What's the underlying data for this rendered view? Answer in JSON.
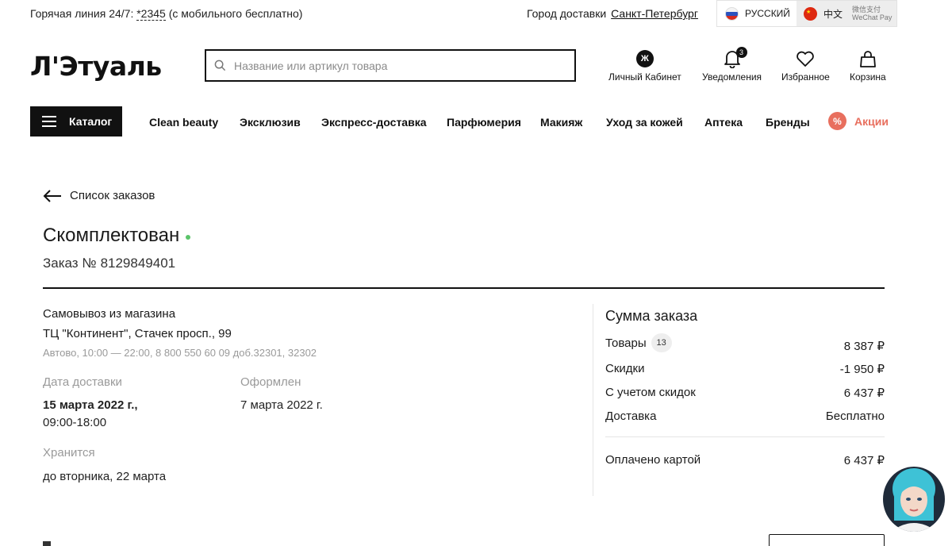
{
  "topbar": {
    "hotline_prefix": "Горячая линия 24/7:",
    "hotline_phone": "*2345",
    "hotline_suffix": "(с мобильного бесплатно)",
    "city_label": "Город доставки",
    "city_value": "Санкт-Петербург",
    "lang_ru": "РУССКИЙ",
    "lang_cn": "中文",
    "wechat_line1": "微信支付",
    "wechat_line2": "WeChat Pay"
  },
  "header": {
    "logo": "Л'Этуаль",
    "search_placeholder": "Название или артикул товара",
    "account_letter": "Ж",
    "account_label": "Личный Кабинет",
    "notifications_label": "Уведомления",
    "notifications_count": "3",
    "favorites_label": "Избранное",
    "cart_label": "Корзина"
  },
  "nav": {
    "catalog": "Каталог",
    "items": [
      "Clean beauty",
      "Эксклюзив",
      "Экспресс-доставка",
      "Парфюмерия",
      "Макияж",
      "Уход за кожей",
      "Аптека",
      "Бренды"
    ],
    "promo_icon": "%",
    "promo_label": "Акции"
  },
  "order": {
    "back_label": "Список заказов",
    "status": "Скомплектован",
    "status_color": "#5bc46a",
    "number_label": "Заказ №",
    "number": "8129849401",
    "pickup_title": "Самовывоз из магазина",
    "pickup_address": "ТЦ \"Континент\", Стачек просп., 99",
    "pickup_info": "Автово, 10:00 — 22:00, 8 800 550 60 09 доб.32301, 32302",
    "delivery_date_label": "Дата доставки",
    "delivery_date": "15 марта 2022 г.,",
    "delivery_time": "09:00-18:00",
    "created_label": "Оформлен",
    "created_date": "7 марта 2022 г.",
    "stored_label": "Хранится",
    "stored_until": "до вторника, 22 марта"
  },
  "summary": {
    "title": "Сумма заказа",
    "items_label": "Товары",
    "items_count": "13",
    "items_value": "8 387 ₽",
    "discount_label": "Скидки",
    "discount_value": "-1 950 ₽",
    "with_discount_label": "С учетом скидок",
    "with_discount_value": "6 437 ₽",
    "delivery_label": "Доставка",
    "delivery_value": "Бесплатно",
    "paid_label": "Оплачено картой",
    "paid_value": "6 437 ₽"
  },
  "colors": {
    "accent_promo": "#e86f5e",
    "primary": "#111111"
  }
}
